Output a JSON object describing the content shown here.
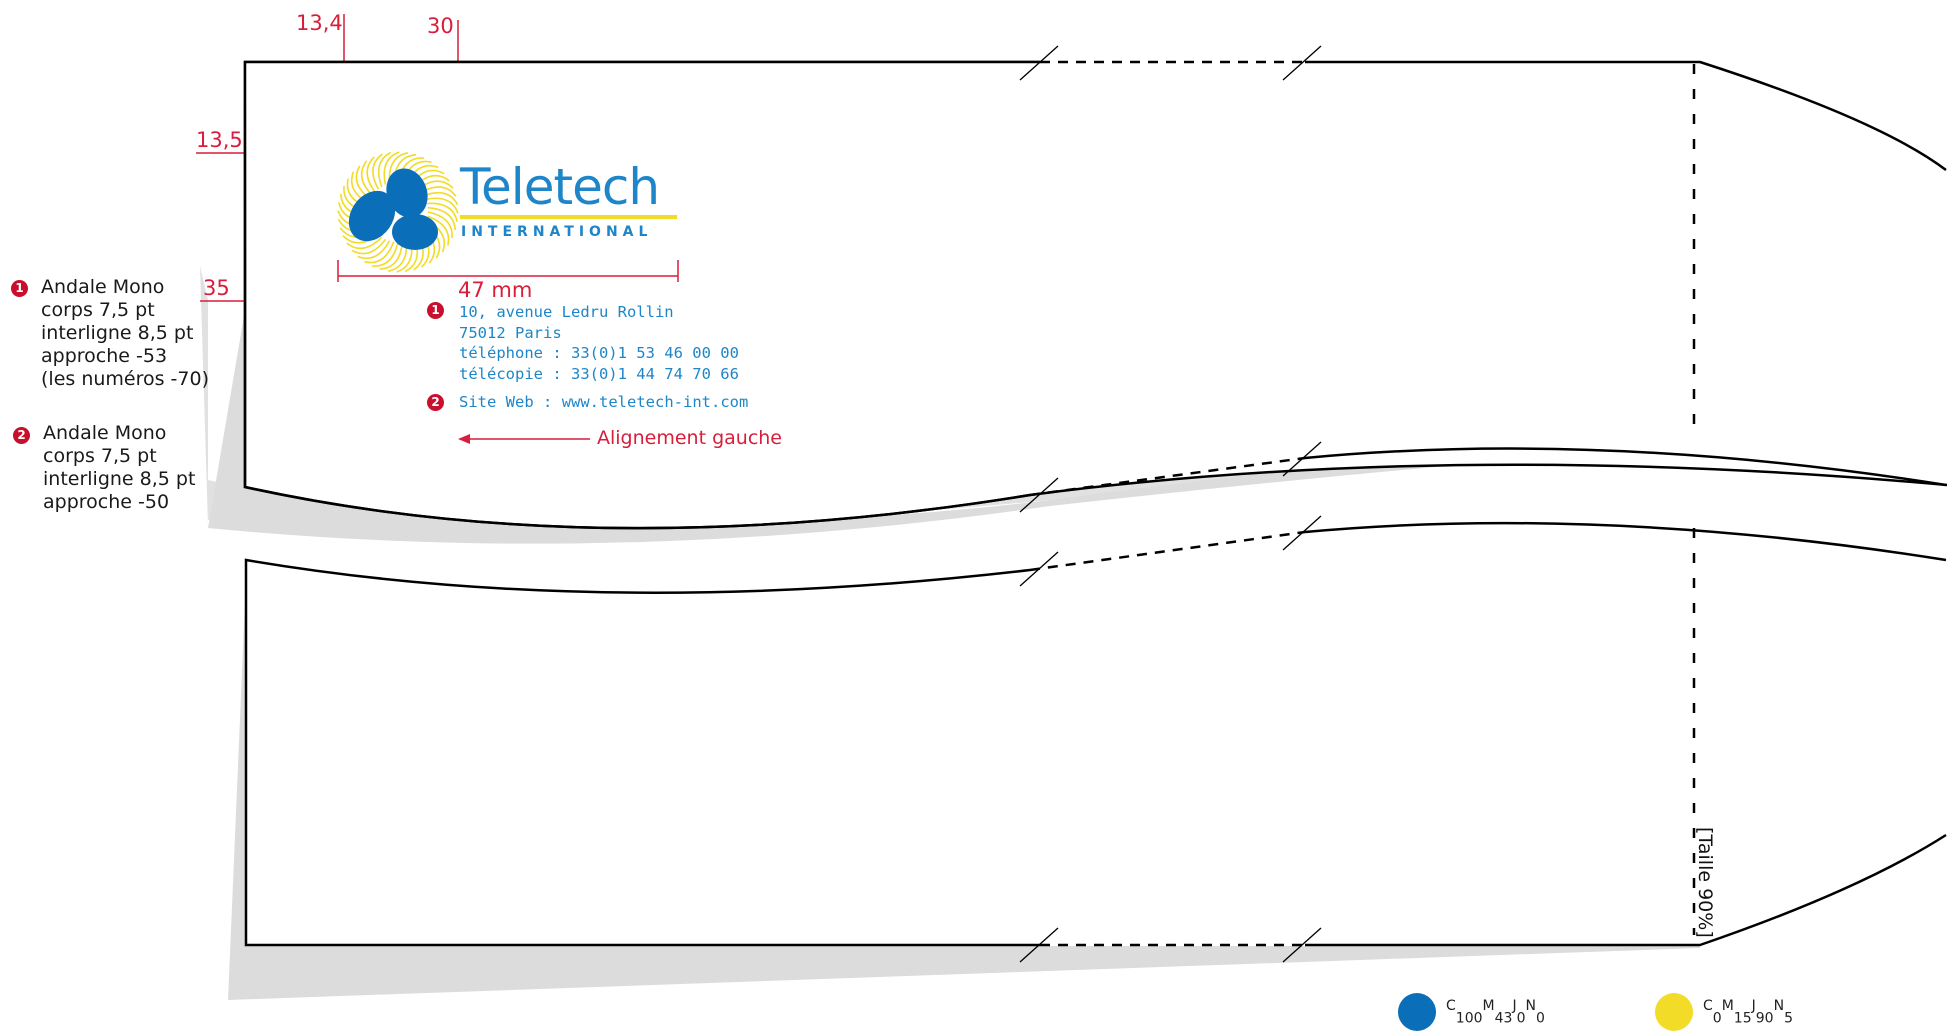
{
  "dimensions": {
    "top_left": "13,4",
    "top_right": "30",
    "left_top": "13,5",
    "left_mid": "35",
    "logo_width": "47 mm"
  },
  "logo": {
    "name": "Teletech",
    "tagline": "INTERNATIONAL"
  },
  "address": {
    "marker": "1",
    "line1": "10, avenue Ledru Rollin",
    "line2": "75012 Paris",
    "line3": "téléphone : 33(0)1 53 46 00 00",
    "line4": "télécopie : 33(0)1 44 74 70 66"
  },
  "website": {
    "marker": "2",
    "label": "Site Web",
    "sep": ":",
    "url": "www.teletech-int.com"
  },
  "alignment_note": "Alignement gauche",
  "notes": [
    {
      "marker": "1",
      "lines": [
        "Andale Mono",
        "corps 7,5 pt",
        "interligne 8,5 pt",
        "approche -53",
        "(les numéros -70)"
      ]
    },
    {
      "marker": "2",
      "lines": [
        "Andale Mono",
        "corps 7,5 pt",
        "interligne 8,5 pt",
        "approche -50"
      ]
    }
  ],
  "size_note": "[Taille 90%]",
  "colors": {
    "blue": "#1e86c8",
    "blue_deep": "#0a6fb8",
    "yellow": "#f2dc28",
    "red_annotation": "#d81e3a"
  },
  "swatches": [
    {
      "color": "#0a6fb8",
      "parts": [
        [
          "C",
          "100"
        ],
        [
          "M",
          "43"
        ],
        [
          "J",
          "0"
        ],
        [
          "N",
          "0"
        ]
      ]
    },
    {
      "color": "#f2dc28",
      "parts": [
        [
          "C",
          "0"
        ],
        [
          "M",
          "15"
        ],
        [
          "J",
          "90"
        ],
        [
          "N",
          "5"
        ]
      ]
    }
  ]
}
